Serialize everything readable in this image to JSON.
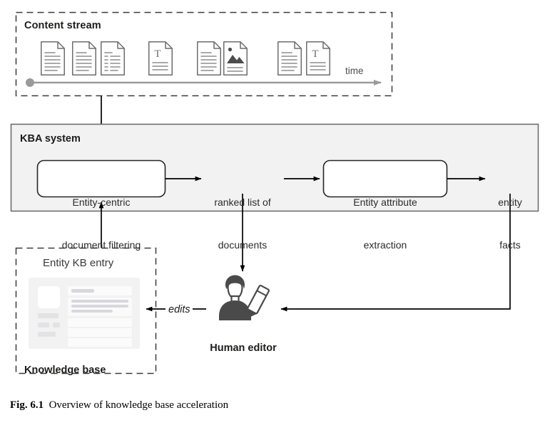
{
  "figure": {
    "caption_label": "Fig. 6.1",
    "caption_text": "Overview of knowledge base acceleration"
  },
  "content_stream": {
    "title": "Content stream",
    "time_axis_label": "time",
    "documents": [
      {
        "icon": "document-text-icon",
        "kind": "text"
      },
      {
        "icon": "document-text-icon",
        "kind": "text"
      },
      {
        "icon": "document-list-icon",
        "kind": "list"
      },
      {
        "icon": "document-typography-icon",
        "kind": "typographic"
      },
      {
        "icon": "document-text-icon",
        "kind": "text"
      },
      {
        "icon": "document-image-icon",
        "kind": "image"
      },
      {
        "icon": "document-text-icon",
        "kind": "text"
      },
      {
        "icon": "document-typography-icon",
        "kind": "typographic"
      }
    ]
  },
  "kba_system": {
    "title": "KBA system",
    "filtering_box": {
      "line1": "Entity-centric",
      "line2": "document filtering"
    },
    "ranked_list": {
      "line1": "ranked list of",
      "line2": "documents"
    },
    "extraction_box": {
      "line1": "Entity attribute",
      "line2": "extraction"
    },
    "entity_facts": {
      "line1": "entity",
      "line2": "facts"
    }
  },
  "knowledge_base": {
    "title": "Knowledge base",
    "entry_caption": "Entity KB entry"
  },
  "editor": {
    "label": "Human editor",
    "icon": "person-with-pencil-icon"
  },
  "edges": {
    "edits_label": "edits"
  },
  "colors": {
    "panel_fill": "#f2f2f2",
    "panel_stroke": "#6e6e6e",
    "dashed_stroke": "#3a3a3a",
    "arrow": "#000000",
    "timeline": "#9a9a9a",
    "doc_outline": "#6d6d6d",
    "doc_fill": "#ffffff",
    "editor_fill": "#4a4a4a",
    "card_fill": "#f2f2f2"
  }
}
